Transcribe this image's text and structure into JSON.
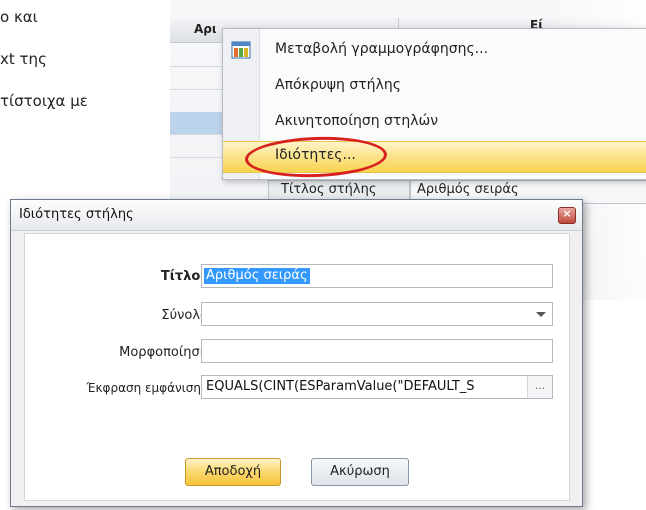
{
  "background_text": {
    "line1": "ο και",
    "line2": "xt της",
    "line3": "τίστοιχα με"
  },
  "grid": {
    "header_col1": "Αρι",
    "header_col2": "Εί",
    "peek_col1": "Τίτλος στήλης",
    "peek_col2": "Αριθμός σειράς"
  },
  "context_menu": {
    "items": [
      {
        "label": "Μεταβολή γραμμογράφησης...",
        "icon": "grid-layout-icon"
      },
      {
        "label": "Απόκρυψη στήλης"
      },
      {
        "label": "Ακινητοποίηση στηλών"
      },
      {
        "label": "Ιδιότητες..."
      }
    ],
    "highlight_color": "#f8d44f",
    "ring_color": "#d8201f"
  },
  "dialog": {
    "title": "Ιδιότητες στήλης",
    "fields": {
      "title_label": "Τίτλος",
      "title_value": "Αριθμός σειράς",
      "total_label": "Σύνολο",
      "total_value": "",
      "format_label": "Μορφοποίηση",
      "format_value": "",
      "expr_label": "Έκφραση εμφάνισης",
      "expr_value": "EQUALS(CINT(ESParamValue(\"DEFAULT_S",
      "expr_button": "..."
    },
    "ok_label": "Αποδοχή",
    "cancel_label": "Ακύρωση"
  }
}
